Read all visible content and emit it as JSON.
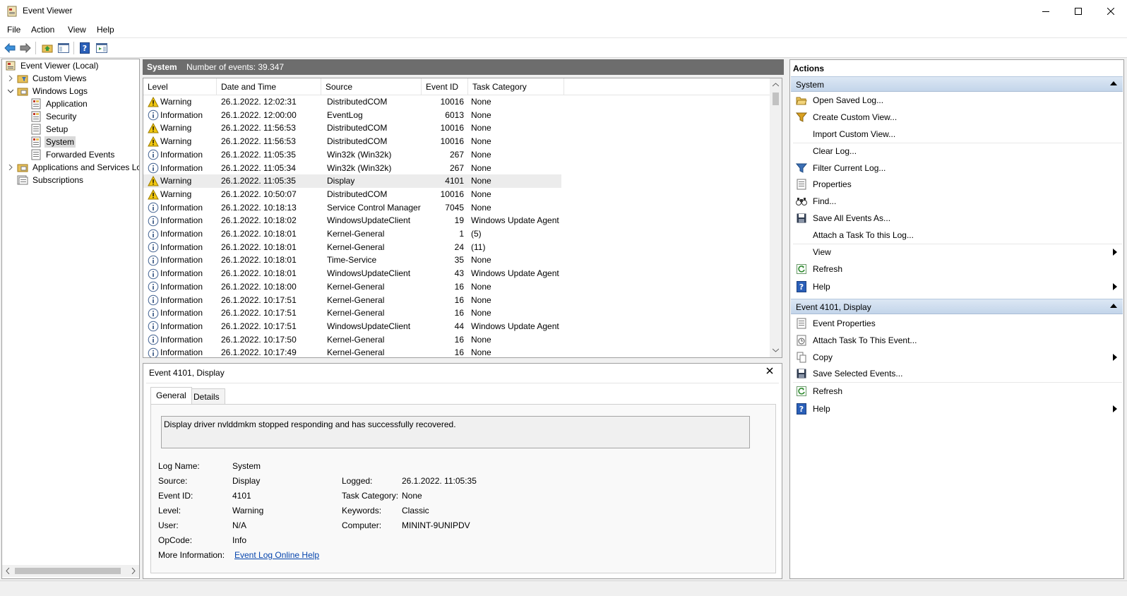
{
  "window": {
    "title": "Event Viewer"
  },
  "menu": {
    "file": "File",
    "action": "Action",
    "view": "View",
    "help": "Help"
  },
  "tree": {
    "root": "Event Viewer (Local)",
    "custom_views": "Custom Views",
    "windows_logs": "Windows Logs",
    "application": "Application",
    "security": "Security",
    "setup": "Setup",
    "system": "System",
    "forwarded": "Forwarded Events",
    "apps_services": "Applications and Services Lo",
    "subscriptions": "Subscriptions"
  },
  "center": {
    "title": "System",
    "count": "Number of events: 39.347"
  },
  "columns": {
    "level": "Level",
    "datetime": "Date and Time",
    "source": "Source",
    "event_id": "Event ID",
    "task_category": "Task Category"
  },
  "events": [
    {
      "level": "Warning",
      "datetime": "26.1.2022. 12:02:31",
      "source": "DistributedCOM",
      "event_id": "10016",
      "category": "None"
    },
    {
      "level": "Information",
      "datetime": "26.1.2022. 12:00:00",
      "source": "EventLog",
      "event_id": "6013",
      "category": "None"
    },
    {
      "level": "Warning",
      "datetime": "26.1.2022. 11:56:53",
      "source": "DistributedCOM",
      "event_id": "10016",
      "category": "None"
    },
    {
      "level": "Warning",
      "datetime": "26.1.2022. 11:56:53",
      "source": "DistributedCOM",
      "event_id": "10016",
      "category": "None"
    },
    {
      "level": "Information",
      "datetime": "26.1.2022. 11:05:35",
      "source": "Win32k (Win32k)",
      "event_id": "267",
      "category": "None"
    },
    {
      "level": "Information",
      "datetime": "26.1.2022. 11:05:34",
      "source": "Win32k (Win32k)",
      "event_id": "267",
      "category": "None"
    },
    {
      "level": "Warning",
      "datetime": "26.1.2022. 11:05:35",
      "source": "Display",
      "event_id": "4101",
      "category": "None"
    },
    {
      "level": "Warning",
      "datetime": "26.1.2022. 10:50:07",
      "source": "DistributedCOM",
      "event_id": "10016",
      "category": "None"
    },
    {
      "level": "Information",
      "datetime": "26.1.2022. 10:18:13",
      "source": "Service Control Manager",
      "event_id": "7045",
      "category": "None"
    },
    {
      "level": "Information",
      "datetime": "26.1.2022. 10:18:02",
      "source": "WindowsUpdateClient",
      "event_id": "19",
      "category": "Windows Update Agent"
    },
    {
      "level": "Information",
      "datetime": "26.1.2022. 10:18:01",
      "source": "Kernel-General",
      "event_id": "1",
      "category": "(5)"
    },
    {
      "level": "Information",
      "datetime": "26.1.2022. 10:18:01",
      "source": "Kernel-General",
      "event_id": "24",
      "category": "(11)"
    },
    {
      "level": "Information",
      "datetime": "26.1.2022. 10:18:01",
      "source": "Time-Service",
      "event_id": "35",
      "category": "None"
    },
    {
      "level": "Information",
      "datetime": "26.1.2022. 10:18:01",
      "source": "WindowsUpdateClient",
      "event_id": "43",
      "category": "Windows Update Agent"
    },
    {
      "level": "Information",
      "datetime": "26.1.2022. 10:18:00",
      "source": "Kernel-General",
      "event_id": "16",
      "category": "None"
    },
    {
      "level": "Information",
      "datetime": "26.1.2022. 10:17:51",
      "source": "Kernel-General",
      "event_id": "16",
      "category": "None"
    },
    {
      "level": "Information",
      "datetime": "26.1.2022. 10:17:51",
      "source": "Kernel-General",
      "event_id": "16",
      "category": "None"
    },
    {
      "level": "Information",
      "datetime": "26.1.2022. 10:17:51",
      "source": "WindowsUpdateClient",
      "event_id": "44",
      "category": "Windows Update Agent"
    },
    {
      "level": "Information",
      "datetime": "26.1.2022. 10:17:50",
      "source": "Kernel-General",
      "event_id": "16",
      "category": "None"
    },
    {
      "level": "Information",
      "datetime": "26.1.2022. 10:17:49",
      "source": "Kernel-General",
      "event_id": "16",
      "category": "None"
    }
  ],
  "detail": {
    "title": "Event 4101, Display",
    "tab_general": "General",
    "tab_details": "Details",
    "description": "Display driver nvlddmkm stopped responding and has successfully recovered.",
    "log_name_label": "Log Name:",
    "log_name": "System",
    "source_label": "Source:",
    "source": "Display",
    "event_id_label": "Event ID:",
    "event_id": "4101",
    "level_label": "Level:",
    "level": "Warning",
    "user_label": "User:",
    "user": "N/A",
    "opcode_label": "OpCode:",
    "opcode": "Info",
    "more_info_label": "More Information:",
    "more_info_link": "Event Log Online Help",
    "logged_label": "Logged:",
    "logged": "26.1.2022. 11:05:35",
    "task_category_label": "Task Category:",
    "task_category": "None",
    "keywords_label": "Keywords:",
    "keywords": "Classic",
    "computer_label": "Computer:",
    "computer": "MININT-9UNIPDV"
  },
  "actions": {
    "title": "Actions",
    "section_system": "System",
    "open_saved_log": "Open Saved Log...",
    "create_custom_view": "Create Custom View...",
    "import_custom_view": "Import Custom View...",
    "clear_log": "Clear Log...",
    "filter_current_log": "Filter Current Log...",
    "properties": "Properties",
    "find": "Find...",
    "save_all_events": "Save All Events As...",
    "attach_task_log": "Attach a Task To this Log...",
    "view": "View",
    "refresh": "Refresh",
    "help": "Help",
    "section_event": "Event 4101, Display",
    "event_properties": "Event Properties",
    "attach_task_event": "Attach Task To This Event...",
    "copy": "Copy",
    "save_selected": "Save Selected Events...",
    "refresh2": "Refresh",
    "help2": "Help"
  }
}
